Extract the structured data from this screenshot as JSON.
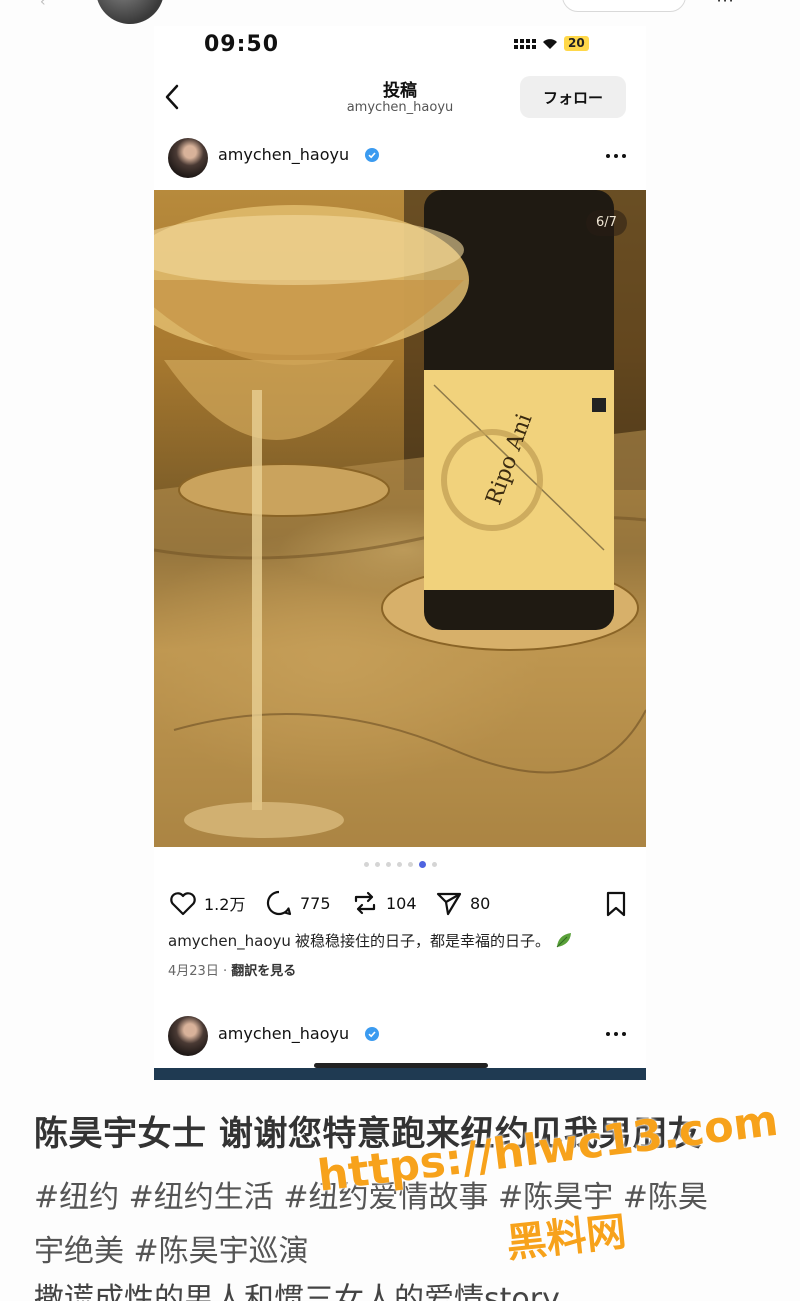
{
  "status_bar": {
    "time": "09:50",
    "battery": "20"
  },
  "header": {
    "title": "投稿",
    "subtitle": "amychen_haoyu",
    "follow_label": "フォロー"
  },
  "post": {
    "username": "amychen_haoyu",
    "image_counter": "6/7",
    "image_description_icon": "wine-photo",
    "likes": "1.2万",
    "comments": "775",
    "reposts": "104",
    "shares": "80",
    "caption_user": "amychen_haoyu",
    "caption_text": "被稳稳接住的日子，都是幸福的日子。",
    "date": "4月23日",
    "translate_label": "翻訳を見る",
    "carousel": {
      "total": 7,
      "active": 6
    }
  },
  "next_post": {
    "username": "amychen_haoyu"
  },
  "article": {
    "headline": "陈昊宇女士 谢谢您特意跑来纽约见我男朋友",
    "tags_line1": "#纽约 #纽约生活 #纽约爱情故事 #陈昊宇 #陈昊",
    "tags_line2": "宇绝美 #陈昊宇巡演",
    "body_line": "撒谎成性的男人和惯三女人的爱情story"
  },
  "watermark": {
    "url": "https://hlwc13.com",
    "site": "黑料网"
  },
  "colors": {
    "accent": "#4f64e0",
    "verified": "#3b9bf0",
    "watermark": "#f7a21b"
  }
}
